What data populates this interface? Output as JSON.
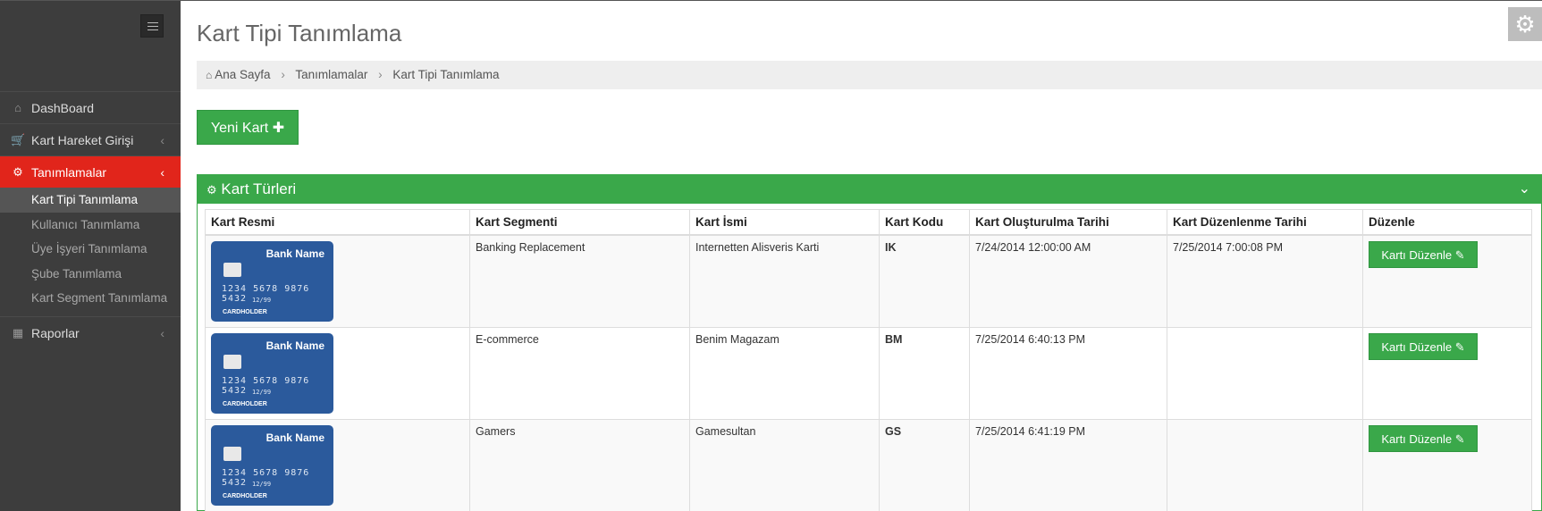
{
  "sidebar": {
    "menu": [
      {
        "label": "DashBoard",
        "icon": "home-icon",
        "has_chevron": false
      },
      {
        "label": "Kart Hareket Girişi",
        "icon": "cart-icon",
        "has_chevron": true
      },
      {
        "label": "Tanımlamalar",
        "icon": "gears-icon",
        "has_chevron": true,
        "active": true
      },
      {
        "label": "Raporlar",
        "icon": "table-icon",
        "has_chevron": true
      }
    ],
    "submenu": [
      {
        "label": "Kart Tipi Tanımlama",
        "active": true
      },
      {
        "label": "Kullanıcı Tanımlama"
      },
      {
        "label": "Üye İşyeri Tanımlama"
      },
      {
        "label": "Şube Tanımlama"
      },
      {
        "label": "Kart Segment Tanımlama"
      }
    ]
  },
  "header": {
    "title": "Kart Tipi Tanımlama",
    "breadcrumb": [
      "Ana Sayfa",
      "Tanımlamalar",
      "Kart Tipi Tanımlama"
    ]
  },
  "toolbar": {
    "new_card_label": "Yeni Kart"
  },
  "panel": {
    "title": "Kart Türleri"
  },
  "table": {
    "columns": [
      "Kart Resmi",
      "Kart Segmenti",
      "Kart İsmi",
      "Kart Kodu",
      "Kart Oluşturulma Tarihi",
      "Kart Düzenlenme Tarihi",
      "Düzenle"
    ],
    "edit_label": "Kartı Düzenle",
    "card_image": {
      "bank_name": "Bank Name",
      "number": "1234 5678 9876 5432",
      "expiry": "12/99",
      "holder": "CARDHOLDER"
    },
    "rows": [
      {
        "segment": "Banking Replacement",
        "name": "Internetten Alisveris Karti",
        "code": "IK",
        "created": "7/24/2014 12:00:00 AM",
        "updated": "7/25/2014 7:00:08 PM"
      },
      {
        "segment": "E-commerce",
        "name": "Benim Magazam",
        "code": "BM",
        "created": "7/25/2014 6:40:13 PM",
        "updated": ""
      },
      {
        "segment": "Gamers",
        "name": "Gamesultan",
        "code": "GS",
        "created": "7/25/2014 6:41:19 PM",
        "updated": ""
      }
    ]
  },
  "colors": {
    "accent_green": "#3aa84a",
    "active_red": "#e1251b",
    "sidebar_bg": "#3d3d3d",
    "card_blue": "#2b5a9c"
  }
}
